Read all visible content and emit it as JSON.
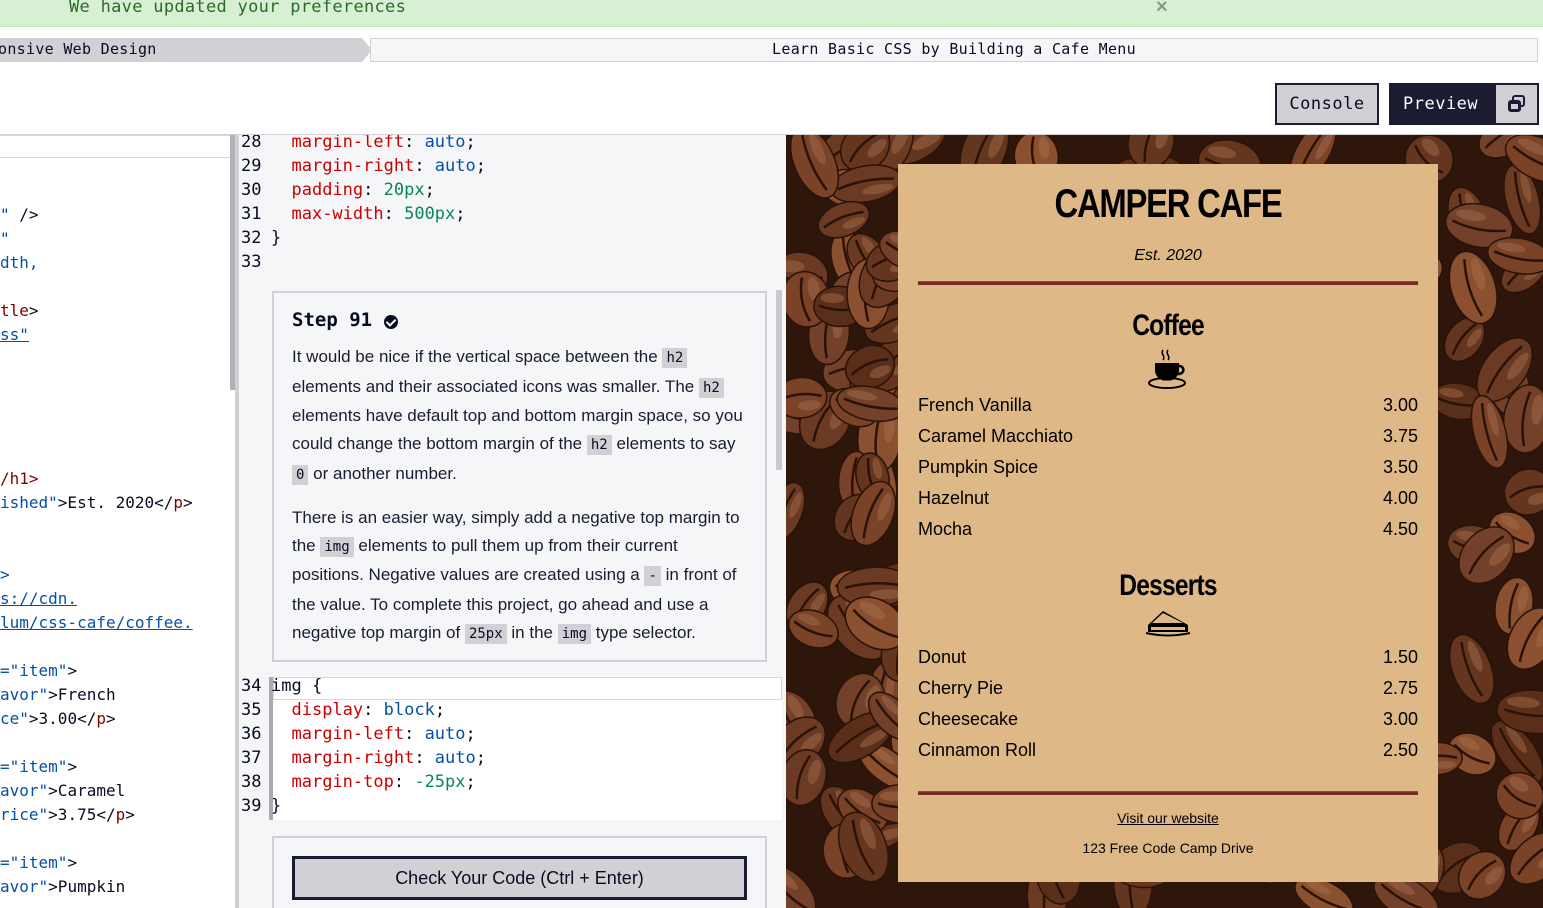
{
  "flash": {
    "message": "We have updated your preferences",
    "close_glyph": "×"
  },
  "breadcrumb": {
    "course": "onsive Web Design",
    "project": "Learn Basic CSS by Building a Cafe Menu"
  },
  "toolbar": {
    "console_label": "Console",
    "preview_label": "Preview"
  },
  "left_editor": {
    "lines": [
      {
        "t1": "\"",
        "t2": " />"
      },
      {
        "t1": "\"",
        "t2": ""
      },
      {
        "t1": "dth,",
        "t2": ""
      },
      {
        "t1": "",
        "t2": ""
      },
      {
        "t1": "tle",
        "t2": ">"
      },
      {
        "t1": "ss\"",
        "t2": ""
      },
      {
        "t1": "/h1>",
        "t2": ""
      },
      {
        "t1": "ished\"",
        "t2": ">Est. 2020</",
        "t3": "p",
        "t4": ">"
      },
      {
        "t1": ">",
        "t2": ""
      },
      {
        "t1": "s://cdn.",
        "t2": ""
      },
      {
        "t1": "lum/css-cafe/coffee.",
        "t2": ""
      },
      {
        "t1": "=\"item\"",
        "t2": ">"
      },
      {
        "t1": "avor\"",
        "t2": ">French"
      },
      {
        "t1": "ce\"",
        "t2": ">3.00</",
        "t3": "p",
        "t4": ">"
      },
      {
        "t1": "=\"item\"",
        "t2": ">"
      },
      {
        "t1": "avor\"",
        "t2": ">Caramel"
      },
      {
        "t1": "rice\"",
        "t2": ">3.75</",
        "t3": "p",
        "t4": ">"
      },
      {
        "t1": "=\"item\"",
        "t2": ">"
      },
      {
        "t1": "avor\"",
        "t2": ">Pumpkin"
      }
    ]
  },
  "css_editor": {
    "top_lines": [
      {
        "n": "28",
        "prop": "margin-left",
        "val": "auto",
        "kind": "val"
      },
      {
        "n": "29",
        "prop": "margin-right",
        "val": "auto",
        "kind": "val"
      },
      {
        "n": "30",
        "prop": "padding",
        "val": "20px",
        "kind": "num"
      },
      {
        "n": "31",
        "prop": "max-width",
        "val": "500px",
        "kind": "num"
      },
      {
        "n": "32",
        "text": "}"
      },
      {
        "n": "33",
        "text": ""
      }
    ],
    "edit_lines": [
      {
        "n": "34",
        "text": "img {"
      },
      {
        "n": "35",
        "prop": "display",
        "val": "block",
        "kind": "val"
      },
      {
        "n": "36",
        "prop": "margin-left",
        "val": "auto",
        "kind": "val"
      },
      {
        "n": "37",
        "prop": "margin-right",
        "val": "auto",
        "kind": "val"
      },
      {
        "n": "38",
        "prop": "margin-top",
        "val": "-25px",
        "kind": "num"
      },
      {
        "n": "39",
        "text": "}"
      }
    ]
  },
  "step": {
    "title": "Step 91",
    "p1": [
      "It would be nice if the vertical space between the ",
      "h2",
      " elements and their associated icons was smaller. The ",
      "h2",
      " elements have default top and bottom margin space, so you could change the bottom margin of the ",
      "h2",
      " elements to say ",
      "0",
      " or another number."
    ],
    "p2": [
      "There is an easier way, simply add a negative top margin to the ",
      "img",
      " elements to pull them up from their current positions. Negative values are created using a ",
      "-",
      " in front of the value. To complete this project, go ahead and use a negative top margin of ",
      "25px",
      " in the ",
      "img",
      " type selector."
    ]
  },
  "check_button": "Check Your Code (Ctrl + Enter)",
  "preview": {
    "title": "CAMPER CAFE",
    "est": "Est. 2020",
    "coffee_heading": "Coffee",
    "coffee": [
      {
        "flavor": "French Vanilla",
        "price": "3.00"
      },
      {
        "flavor": "Caramel Macchiato",
        "price": "3.75"
      },
      {
        "flavor": "Pumpkin Spice",
        "price": "3.50"
      },
      {
        "flavor": "Hazelnut",
        "price": "4.00"
      },
      {
        "flavor": "Mocha",
        "price": "4.50"
      }
    ],
    "desserts_heading": "Desserts",
    "desserts": [
      {
        "flavor": "Donut",
        "price": "1.50"
      },
      {
        "flavor": "Cherry Pie",
        "price": "2.75"
      },
      {
        "flavor": "Cheesecake",
        "price": "3.00"
      },
      {
        "flavor": "Cinnamon Roll",
        "price": "2.50"
      }
    ],
    "footer_link": "Visit our website",
    "address": "123 Free Code Camp Drive"
  },
  "icons": [
    "close-icon",
    "popout-icon",
    "check-circle-icon",
    "coffee-cup-icon",
    "pie-icon"
  ]
}
